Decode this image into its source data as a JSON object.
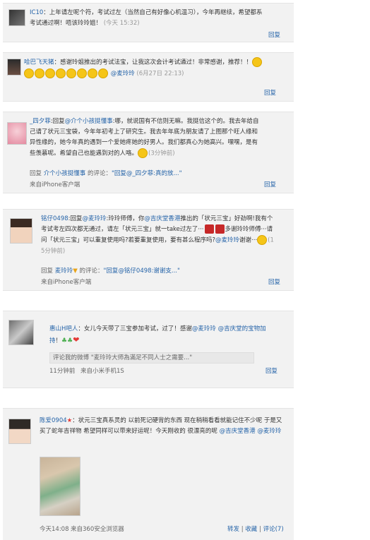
{
  "cards": [
    {
      "name": "IC10",
      "text": "：上年请左呢个符，考试过左（当然自己有好像心机温习），今年再继续，希望都系考试通过啊！唔该玲玲姐！",
      "time": "(今天 15:32)",
      "reply": "回复"
    },
    {
      "name": "哈巴飞天猪",
      "text": "：感谢玲姐推出的考试法宝，让我这次会计考试通过！非常感谢，推荐！！",
      "mention": "@麦玲玲",
      "time": "(6月27日 22:13)",
      "reply": "回复"
    },
    {
      "name": "_四夕菲",
      "reply_prefix": ":回复",
      "reply_target": "@介个小孩挺懂事",
      "text": ":哪，就说国有不信则无嘛。我挺信这个的。我去年给自己请了状元三宝袋，今年年初考上了研究生。我去年年底为朋友请了上图那个旺人缘和异性缘的，她今年真的遇到一个爱她疼她的好男人。我们都真心为她高兴。嘿嘿，是有些羡慕呢。希望自己也能遇到对的人咯。",
      "time": "(3分钟前)",
      "sub_reply_prefix": "回复",
      "sub_reply_user": "介个小孩挺懂事",
      "sub_comment_label": "的评论：",
      "sub_comment": "\"回复@_四夕菲:真的放...\"",
      "source": "来自iPhone客户端",
      "reply": "回复"
    },
    {
      "name": "铭仔0498",
      "reply_prefix": ":回复",
      "reply_target": "@麦玲玲",
      "text1": ":玲玲师傅，你",
      "mention1": "@吉庆堂香港",
      "text2": "推出的「状元三宝」好劲啊!我有个考试考左四次都无通过，请左「状元三宝」就一take过左了···",
      "text3": "多谢玲玲师傅···请问「状元三宝」可以重复使用吗?若要重复使用，要有甚么程序吗?",
      "mention2": "@麦玲玲",
      "text4": "谢谢···",
      "time": "(15分钟前)",
      "sub_reply_prefix": "回复",
      "sub_reply_user": "麦玲玲",
      "sub_comment_label": "的评论：",
      "sub_comment": "\"回复@铭仔0498:谢谢支...\"",
      "source": "来自iPhone客户端",
      "reply": "回复"
    },
    {
      "name": "惠山H吧人",
      "text1": "：女儿今天带了三宝参加考试，过了！感谢",
      "mention1": "@麦玲玲",
      "mention2": "@吉庆堂的宝物加持",
      "text2": "！",
      "quote": "评论我的微博 \"麦玲玲大师為滿足不同人士之需要...\"",
      "time": "11分钟前",
      "source": "来自小米手机1S",
      "reply": "回复"
    },
    {
      "name": "陈爱0904",
      "text": "：状元三宝真系灵的 以前死记硬背的东西 现在稍稍看看就能记住不少呢 于是又买了蛇年吉祥物 希望同样可以带来好运呢！今天刚收的 很漂亮的呢",
      "mention1": "@吉庆堂香港",
      "mention2": "@麦玲玲",
      "time": "今天14:08",
      "source": "来自360安全浏览器",
      "actions": [
        "转发",
        "收藏",
        "评论(7)"
      ]
    }
  ]
}
